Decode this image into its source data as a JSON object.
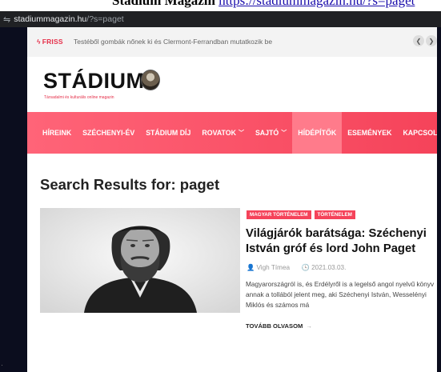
{
  "browser": {
    "url_host": "stadiummagazin.hu",
    "url_path": "/?s=paget"
  },
  "top_strip": {
    "text": "Stádium Magazin",
    "link": "https://stadiummagazin.hu/?s=paget"
  },
  "ticker": {
    "label": "FRISS",
    "headline": "Testéből gombák nőnek ki és Clermont-Ferrandban mutatkozik be"
  },
  "logo": {
    "word": "STÁDIUM",
    "tagline": "Társadalmi és kulturális online magazin"
  },
  "nav": {
    "items": [
      {
        "label": "HÍREINK",
        "dropdown": false
      },
      {
        "label": "SZÉCHENYI-ÉV",
        "dropdown": false
      },
      {
        "label": "STÁDIUM DÍJ",
        "dropdown": false
      },
      {
        "label": "ROVATOK",
        "dropdown": true
      },
      {
        "label": "SAJTÓ",
        "dropdown": true
      },
      {
        "label": "HÍDÉPÍTŐK",
        "dropdown": false
      },
      {
        "label": "ESEMÉNYEK",
        "dropdown": false
      },
      {
        "label": "KAPCSOLAT",
        "dropdown": false
      }
    ]
  },
  "search": {
    "heading": "Search Results for: paget"
  },
  "result": {
    "categories": [
      "MAGYAR TÖRTÉNELEM",
      "TÖRTÉNELEM"
    ],
    "title": "Világjárók barátsága: Széchenyi István gróf és lord John Paget",
    "author": "Vigh Tímea",
    "date": "2021.03.03.",
    "excerpt": "Magyarországról is, és Erdélyről is a legelső angol nyelvű könyv annak a tollából jelent meg, aki Széchenyi István, Wesselényi Miklós és számos má",
    "read_more": "TOVÁBB OLVASOM"
  },
  "colors": {
    "accent": "#f5435a",
    "nav_gradient_start": "#ff6478",
    "dark_frame": "#0b0d1e"
  }
}
